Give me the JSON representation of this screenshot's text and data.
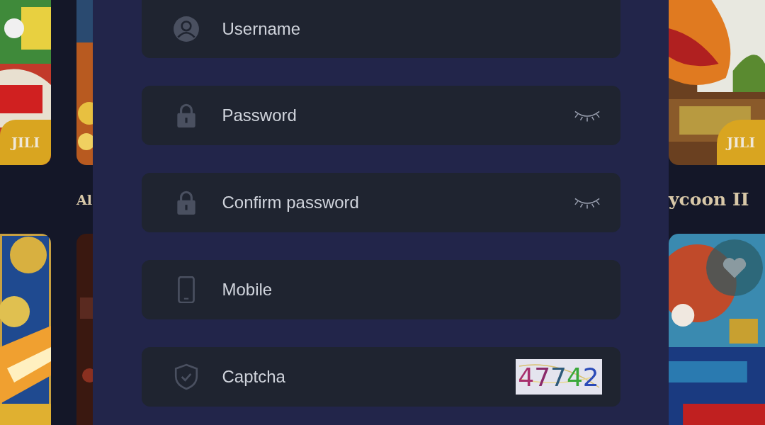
{
  "background_games": {
    "left_badges": [
      "JILI"
    ],
    "left_title": "Al",
    "right_badge": "JILI",
    "right_title": "ycoon II"
  },
  "form": {
    "fields": [
      {
        "kind": "user",
        "placeholder": "Username"
      },
      {
        "kind": "password",
        "placeholder": "Password",
        "masked": true
      },
      {
        "kind": "password",
        "placeholder": "Confirm password",
        "masked": true
      },
      {
        "kind": "mobile",
        "placeholder": "Mobile"
      },
      {
        "kind": "captcha",
        "placeholder": "Captcha",
        "captcha": [
          {
            "digit": "4",
            "color": "#a8306e"
          },
          {
            "digit": "7",
            "color": "#8a2a6a"
          },
          {
            "digit": "7",
            "color": "#2e5a7a"
          },
          {
            "digit": "4",
            "color": "#3aa83a"
          },
          {
            "digit": "2",
            "color": "#2a4ab8"
          }
        ]
      }
    ]
  }
}
